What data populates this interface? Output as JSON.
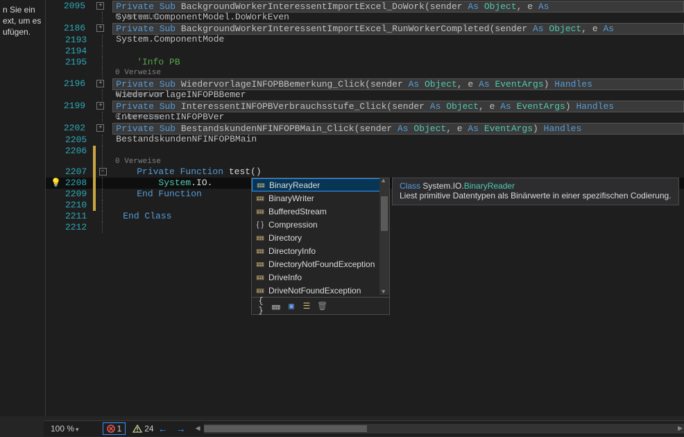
{
  "side_panel": {
    "line1": "n Sie ein",
    "line2": "ext, um es",
    "line3": "ufügen."
  },
  "code": {
    "rows": [
      {
        "ln": "2095",
        "fold": "plus",
        "type": "sig",
        "text": "Private Sub BackgroundWorkerInteressentImportExcel_DoWork(sender As Object, e As System.ComponentModel.DoWorkEven"
      },
      {
        "ln": "",
        "type": "refs",
        "text": "0 Verweise"
      },
      {
        "ln": "2186",
        "fold": "plus",
        "type": "sig",
        "text": "Private Sub BackgroundWorkerInteressentImportExcel_RunWorkerCompleted(sender As Object, e As System.ComponentMode"
      },
      {
        "ln": "2193",
        "type": "blank"
      },
      {
        "ln": "2194",
        "type": "blank"
      },
      {
        "ln": "2195",
        "type": "comment",
        "text": "'Info PB"
      },
      {
        "ln": "",
        "type": "refs",
        "text": "0 Verweise"
      },
      {
        "ln": "2196",
        "fold": "plus",
        "type": "sig",
        "text": "Private Sub WiedervorlageINFOPBBemerkung_Click(sender As Object, e As EventArgs) Handles WiedervorlageINFOPBBemer"
      },
      {
        "ln": "",
        "type": "refs",
        "text": "0 Verweise"
      },
      {
        "ln": "2199",
        "fold": "plus",
        "type": "sig",
        "text": "Private Sub InteressentINFOPBVerbrauchsstufe_Click(sender As Object, e As EventArgs) Handles InteressentINFOPBVer"
      },
      {
        "ln": "",
        "type": "refs",
        "text": "0 Verweise"
      },
      {
        "ln": "2202",
        "fold": "plus",
        "type": "sig",
        "text": "Private Sub BestandskundenNFINFOPBMain_Click(sender As Object, e As EventArgs) Handles BestandskundenNFINFOPBMain"
      },
      {
        "ln": "2205",
        "type": "blank"
      },
      {
        "ln": "2206",
        "type": "blank",
        "changed": true
      },
      {
        "ln": "",
        "type": "refs",
        "text": "0 Verweise",
        "changed": true
      },
      {
        "ln": "2207",
        "fold": "minus",
        "type": "code",
        "changed": true,
        "html": "<span class='kw'>Private Function</span> <span class='ident'>test</span>()"
      },
      {
        "ln": "2208",
        "type": "code",
        "changed": true,
        "cursor": true,
        "bulb": true,
        "html": "    <span class='type'>System</span><span class='ident'>.IO.</span>"
      },
      {
        "ln": "2209",
        "type": "code",
        "changed": true,
        "html": "<span class='kw'>End Function</span>"
      },
      {
        "ln": "2210",
        "type": "blank",
        "changed": true
      },
      {
        "ln": "2211",
        "type": "code",
        "html": "<span class='kw' style='margin-left:-20px'>End Class</span>"
      },
      {
        "ln": "2212",
        "type": "blank"
      }
    ]
  },
  "intellisense": {
    "items": [
      {
        "icon": "class",
        "label": "BinaryReader",
        "selected": true
      },
      {
        "icon": "class",
        "label": "BinaryWriter"
      },
      {
        "icon": "class",
        "label": "BufferedStream"
      },
      {
        "icon": "ns",
        "label": "Compression"
      },
      {
        "icon": "class",
        "label": "Directory"
      },
      {
        "icon": "class",
        "label": "DirectoryInfo"
      },
      {
        "icon": "class",
        "label": "DirectoryNotFoundException"
      },
      {
        "icon": "class",
        "label": "DriveInfo"
      },
      {
        "icon": "class",
        "label": "DriveNotFoundException"
      }
    ]
  },
  "tooltip": {
    "kind": "Class",
    "ns": "System.IO.",
    "name": "BinaryReader",
    "desc": "Liest primitive Datentypen als Binärwerte in einer spezifischen Codierung."
  },
  "statusbar": {
    "zoom": "100 %",
    "errors": "1",
    "warnings": "24"
  }
}
